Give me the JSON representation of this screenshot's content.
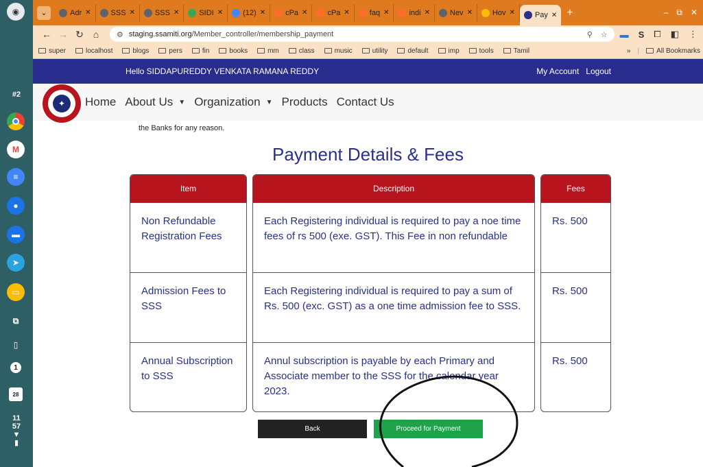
{
  "shelf": {
    "desk_label": "#2",
    "clock_hour": "11",
    "clock_minute": "57",
    "calendar_day": "28",
    "notification_count": "1",
    "apps": [
      "chrome-icon",
      "gmail-icon",
      "docs-icon",
      "chat-icon",
      "files-icon",
      "telegram-icon",
      "keep-icon",
      "screen-capture-icon",
      "phone-hub-icon"
    ]
  },
  "browser": {
    "tabs": [
      {
        "label": "Adr",
        "color": "#5f6368"
      },
      {
        "label": "SSS",
        "color": "#5f6368"
      },
      {
        "label": "SSS",
        "color": "#5f6368"
      },
      {
        "label": "SIDI",
        "color": "#34a853"
      },
      {
        "label": "(12)",
        "color": "#4285f4"
      },
      {
        "label": "cPa",
        "color": "#ff6c2c"
      },
      {
        "label": "cPa",
        "color": "#ff6c2c"
      },
      {
        "label": "faq",
        "color": "#ff6c2c"
      },
      {
        "label": "indi",
        "color": "#ff6c2c"
      },
      {
        "label": "Nev",
        "color": "#5f6368"
      },
      {
        "label": "Hov",
        "color": "#fbbc04"
      },
      {
        "label": "Pay",
        "color": "#28308a",
        "active": true
      }
    ],
    "url_host": "staging.ssamiti.org",
    "url_path": "/Member_controller/membership_payment",
    "bookmarks": [
      "super",
      "localhost",
      "blogs",
      "pers",
      "fin",
      "books",
      "mm",
      "class",
      "music",
      "utility",
      "default",
      "imp",
      "tools",
      "Tamil"
    ],
    "all_bookmarks": "All Bookmarks",
    "overflow": "»"
  },
  "page": {
    "greeting": "Hello SIDDAPUREDDY VENKATA RAMANA REDDY",
    "my_account": "My Account",
    "logout": "Logout",
    "menu": {
      "home": "Home",
      "about": "About Us",
      "organization": "Organization",
      "products": "Products",
      "contact": "Contact Us"
    },
    "cut_text": "the Banks for any reason.",
    "heading": "Payment Details & Fees",
    "table": {
      "headers": {
        "item": "Item",
        "description": "Description",
        "fees": "Fees"
      },
      "rows": [
        {
          "item": "Non Refundable Registration Fees",
          "description": "Each Registering individual is required to pay a noe time fees of rs 500 (exe. GST). This Fee in non refundable",
          "fees": "Rs. 500"
        },
        {
          "item": "Admission Fees to SSS",
          "description": "Each Registering individual is required to pay a sum of Rs. 500 (exc. GST) as a one time admission fee to SSS.",
          "fees": "Rs. 500"
        },
        {
          "item": "Annual Subscription to SSS",
          "description": "Annul subscription is payable by each Primary and Associate member to the SSS for the calendar year 2023.",
          "fees": "Rs. 500"
        }
      ]
    },
    "back_label": "Back",
    "proceed_label": "Proceed for Payment"
  },
  "colors": {
    "tabstrip": "#e07a1e",
    "topbar": "#282c8c",
    "table_header": "#b8141e",
    "proceed": "#1fa34a",
    "back": "#222222"
  }
}
